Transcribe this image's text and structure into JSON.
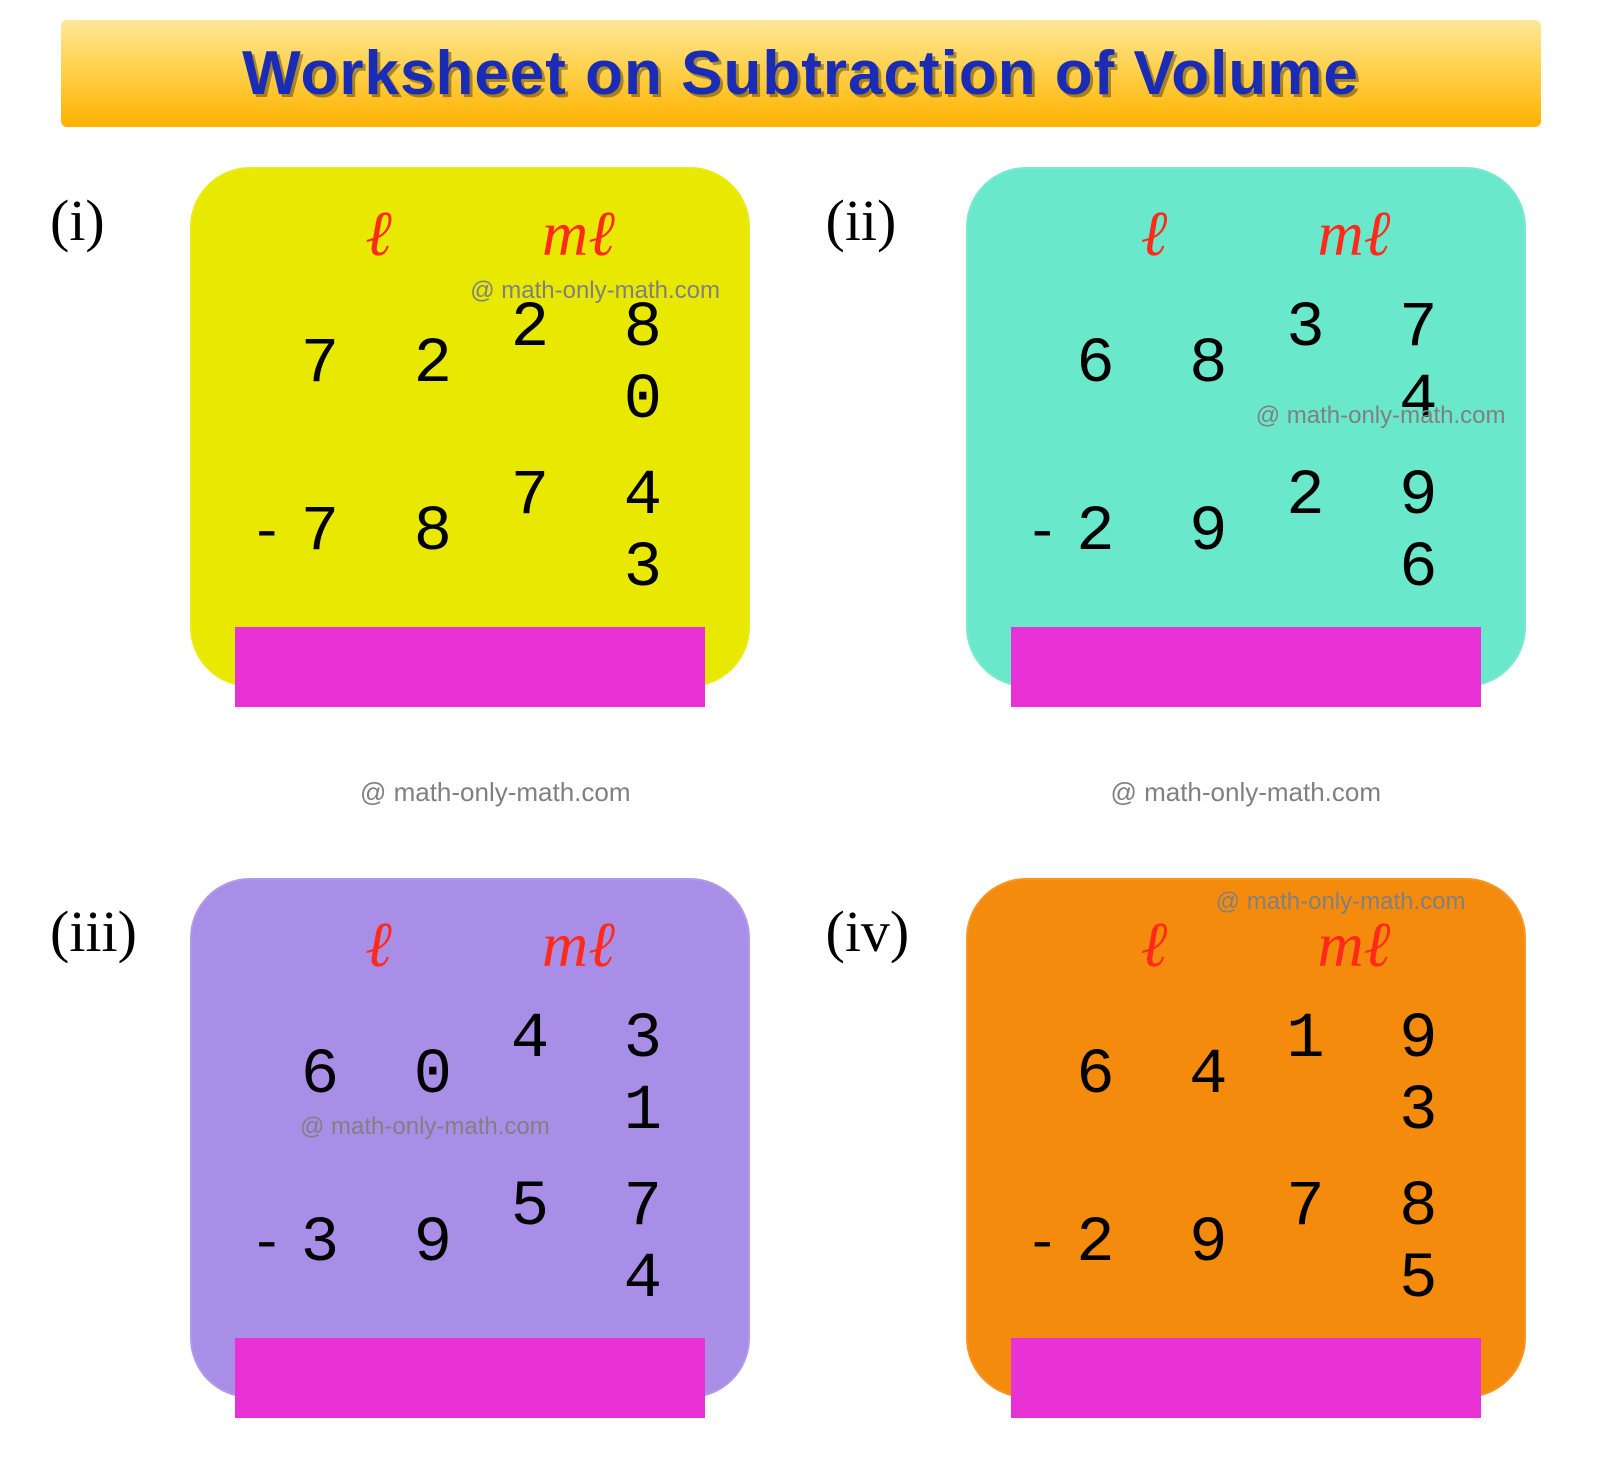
{
  "title": "Worksheet on Subtraction of Volume",
  "unit_l": "ℓ",
  "unit_ml": "mℓ",
  "attribution": "@ math-only-math.com",
  "problems": [
    {
      "label": "(i)",
      "card_color": "yellow",
      "top_l": "7 2",
      "top_ml": "2 8 0",
      "bot_l": "7 8",
      "bot_ml": "7 4 3",
      "attrib_style": "top:110px; right:30px;"
    },
    {
      "label": "(ii)",
      "card_color": "teal",
      "top_l": "6 8",
      "top_ml": "3 7 4",
      "bot_l": "2 9",
      "bot_ml": "2 9 6",
      "attrib_style": "top:235px; right:20px;"
    },
    {
      "label": "(iii)",
      "card_color": "purple",
      "top_l": "6 0",
      "top_ml": "4 3 1",
      "bot_l": "3 9",
      "bot_ml": "5 7 4",
      "attrib_style": "top:235px; left:110px;"
    },
    {
      "label": "(iv)",
      "card_color": "orange",
      "top_l": "6 4",
      "top_ml": "1 9 3",
      "bot_l": "2 9",
      "bot_ml": "7 8 5",
      "attrib_style": "top:10px; right:60px;"
    }
  ]
}
